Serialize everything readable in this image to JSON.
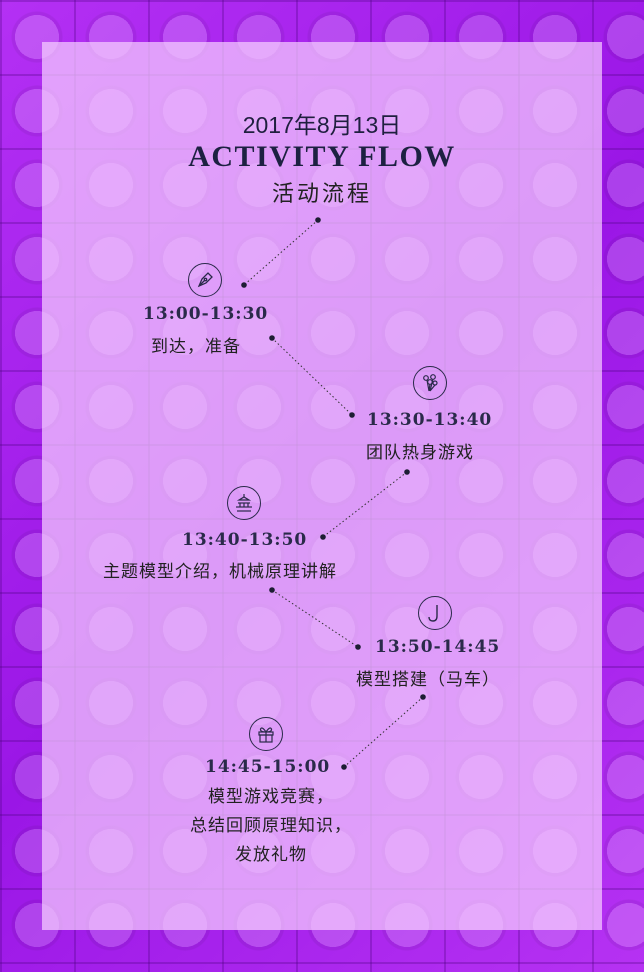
{
  "header": {
    "date": "2017年8月13日",
    "title": "ACTIVITY FLOW",
    "subtitle": "活动流程"
  },
  "schedule": [
    {
      "time": "13:00-13:30",
      "desc": "到达，准备",
      "icon": "pen-nib-icon"
    },
    {
      "time": "13:30-13:40",
      "desc": "团队热身游戏",
      "icon": "flowers-icon"
    },
    {
      "time": "13:40-13:50",
      "desc": "主题模型介绍，机械原理讲解",
      "icon": "tower-icon"
    },
    {
      "time": "13:50-14:45",
      "desc": "模型搭建（马车）",
      "icon": "hook-icon"
    },
    {
      "time": "14:45-15:00",
      "desc_lines": [
        "模型游戏竞赛，",
        "总结回顾原理知识，",
        "发放礼物"
      ],
      "icon": "gift-icon"
    }
  ],
  "colors": {
    "ink": "#2a2a4a",
    "panel": "#f5cdff",
    "background": "#a31be8"
  }
}
